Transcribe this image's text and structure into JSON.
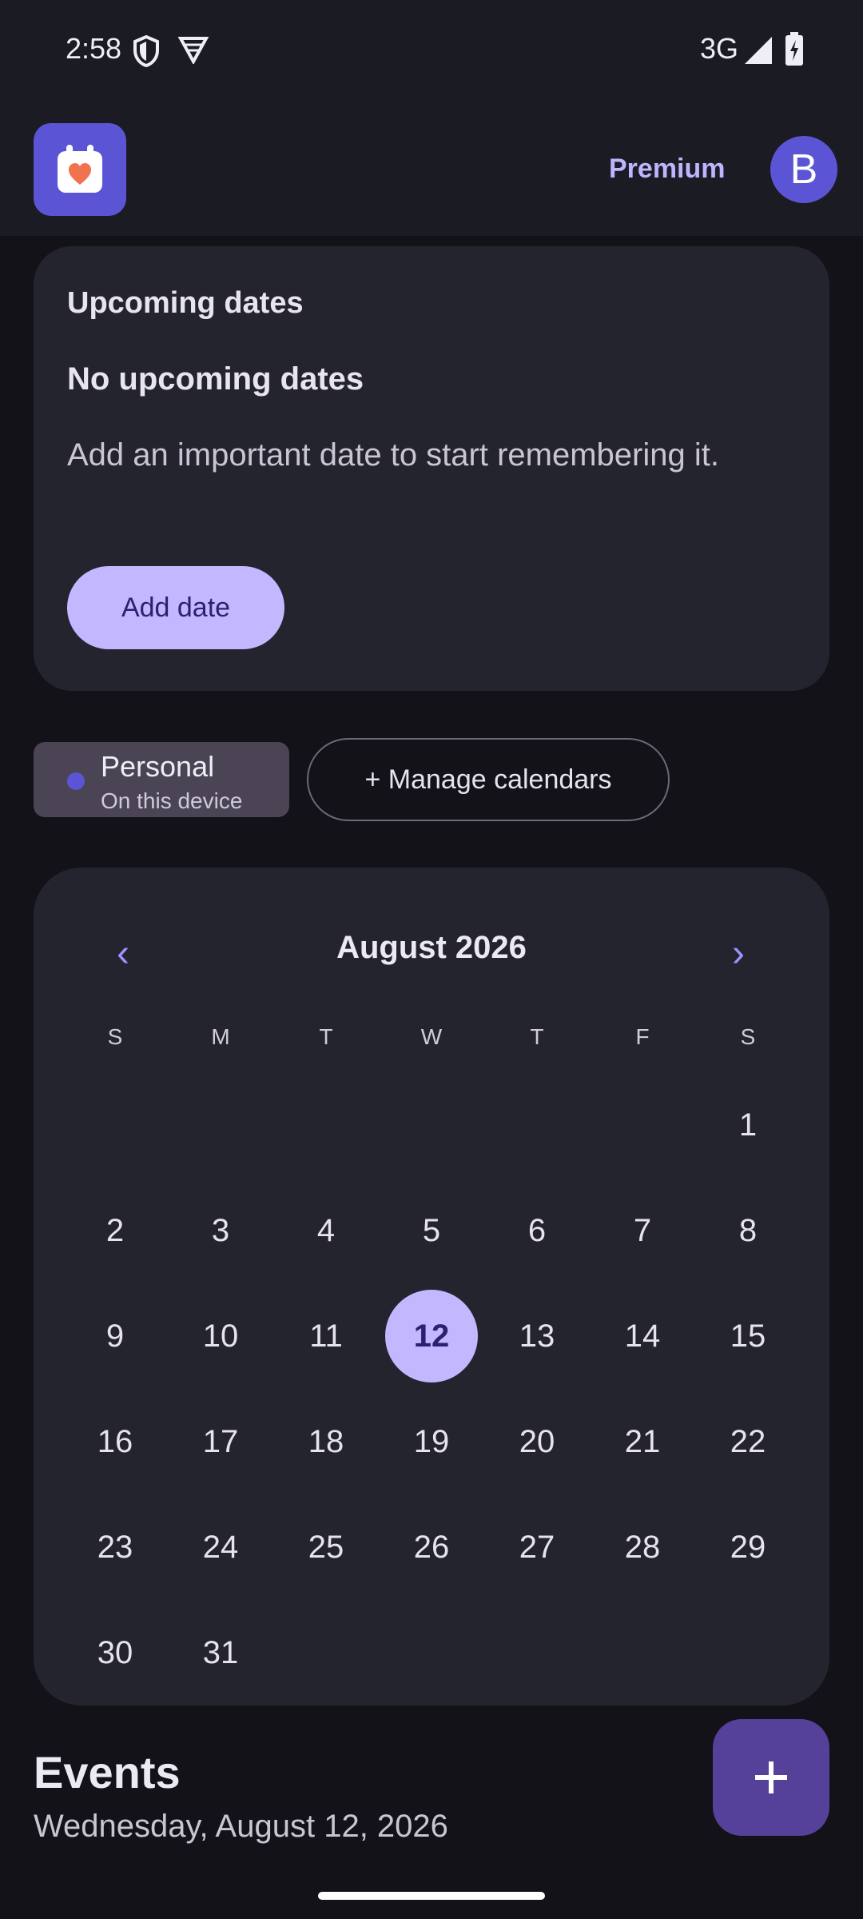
{
  "status_bar": {
    "time": "2:58",
    "network": "3G"
  },
  "app_bar": {
    "premium_label": "Premium",
    "avatar_initial": "B"
  },
  "upcoming": {
    "heading": "Upcoming dates",
    "empty_title": "No upcoming dates",
    "empty_description": "Add an important date to start remembering it.",
    "add_button": "Add date"
  },
  "calendars": {
    "personal_title": "Personal",
    "personal_subtitle": "On this device",
    "manage_label": "+ Manage calendars"
  },
  "calendar": {
    "prev_label": "‹",
    "next_label": "›",
    "month_label": "August 2026",
    "weekdays": [
      "S",
      "M",
      "T",
      "W",
      "T",
      "F",
      "S"
    ],
    "first_weekday_index": 6,
    "days_in_month": 31,
    "selected_day": 12
  },
  "events": {
    "title": "Events",
    "date_label": "Wednesday, August 12, 2026"
  },
  "colors": {
    "accent": "#5b55d6",
    "selected_day": "#c3b8ff",
    "fab": "#55409a"
  }
}
